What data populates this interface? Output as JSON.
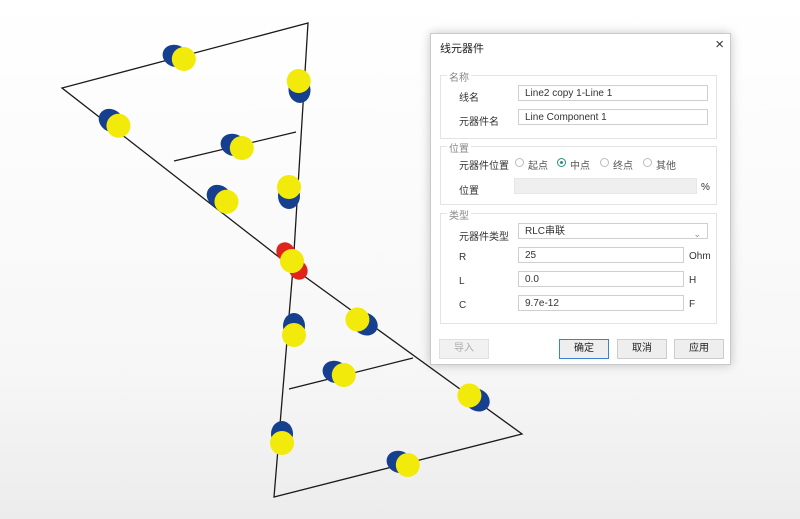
{
  "dialog": {
    "title": "线元器件",
    "close_glyph": "×",
    "groups": {
      "name": {
        "title": "名称",
        "line_name_label": "线名",
        "line_name_value": "Line2 copy 1-Line 1",
        "component_name_label": "元器件名",
        "component_name_value": "Line Component 1"
      },
      "position": {
        "title": "位置",
        "component_position_label": "元器件位置",
        "options": [
          "起点",
          "中点",
          "终点",
          "其他"
        ],
        "selected": "中点",
        "position_label": "位置",
        "position_unit": "%"
      },
      "type": {
        "title": "类型",
        "component_type_label": "元器件类型",
        "component_type_value": "RLC串联",
        "r_label": "R",
        "r_value": "25",
        "r_unit": "Ohm",
        "l_label": "L",
        "l_value": "0.0",
        "l_unit": "H",
        "c_label": "C",
        "c_value": "9.7e-12",
        "c_unit": "F"
      }
    },
    "buttons": {
      "import": "导入",
      "ok": "确定",
      "cancel": "取消",
      "apply": "应用"
    }
  },
  "colors": {
    "component_yellow": "#f2ea0a",
    "component_blue": "#173f8f",
    "selected_red": "#e0231b",
    "accent_radio": "#2a8f7a",
    "primary_button_border": "#3d82d0"
  }
}
